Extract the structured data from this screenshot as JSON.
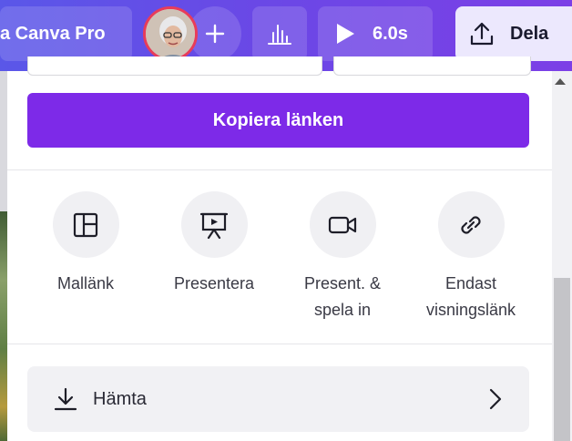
{
  "topbar": {
    "pro_label": "a Canva Pro",
    "duration": "6.0s",
    "share_label": "Dela"
  },
  "panel": {
    "copy_link_label": "Kopiera länken",
    "options": [
      {
        "label": "Mallänk",
        "icon": "template-link-icon"
      },
      {
        "label": "Presentera",
        "icon": "present-icon"
      },
      {
        "label": "Present. & spela in",
        "icon": "record-video-icon"
      },
      {
        "label": "Endast visningslänk",
        "icon": "link-icon"
      }
    ],
    "download_label": "Hämta"
  },
  "colors": {
    "topbar_start": "#5a57e8",
    "topbar_end": "#7c3fe6",
    "accent": "#7d2ae8",
    "share_button_bg": "#ece8fd",
    "avatar_border": "#e83c5a"
  }
}
